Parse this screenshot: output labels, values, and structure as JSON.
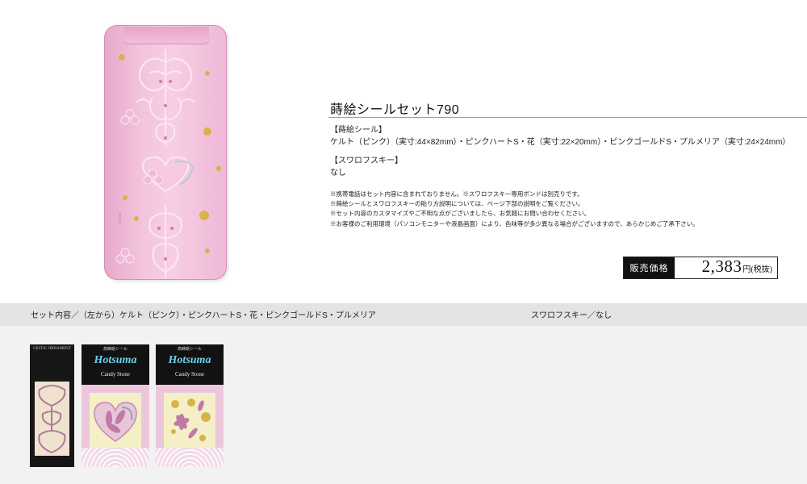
{
  "product": {
    "title": "蒔絵シールセット790"
  },
  "specs": {
    "maki_heading": "【蒔絵シール】",
    "maki_value": "ケルト（ピンク）（実寸:44×82mm）・ピンクハートS・花（実寸:22×20mm）・ピンクゴールドS・プルメリア（実寸:24×24mm）",
    "swarovski_heading": "【スワロフスキー】",
    "swarovski_value": "なし"
  },
  "notes": [
    "※携帯電話はセット内容に含まれておりません。※スワロフスキー専用ボンドは別売りです。",
    "※蒔絵シールとスワロフスキーの貼り方説明については、ページ下部の説明をご覧ください。",
    "※セット内容のカスタマイズやご不明な点がございましたら、お気軽にお問い合わせください。",
    "※お客様のご利用環境（パソコンモニターや液晶画面）により、色味等が多少異なる場合がございますので、あらかじめご了承下さい。"
  ],
  "price": {
    "label": "販売価格",
    "value": "2,383",
    "unit": "円(税抜)"
  },
  "band": {
    "left": "セット内容／（左から）ケルト（ピンク）・ピンクハートS・花・ピンクゴールドS・プルメリア",
    "right": "スワロフスキー／なし"
  },
  "cards": {
    "pink_small_label": "高蒔絵シール",
    "pink_logo": "Hotsuma",
    "pink_sub": "Candy Stone",
    "black_top": "CELTIC ORNAMENT"
  },
  "colors": {
    "phone_pink": "#f3c3dd",
    "card_pink": "#ecc7dc",
    "logo_blue": "#6fd0ef",
    "gold": "#d8b24a",
    "band_gray": "#e3e3e3"
  }
}
